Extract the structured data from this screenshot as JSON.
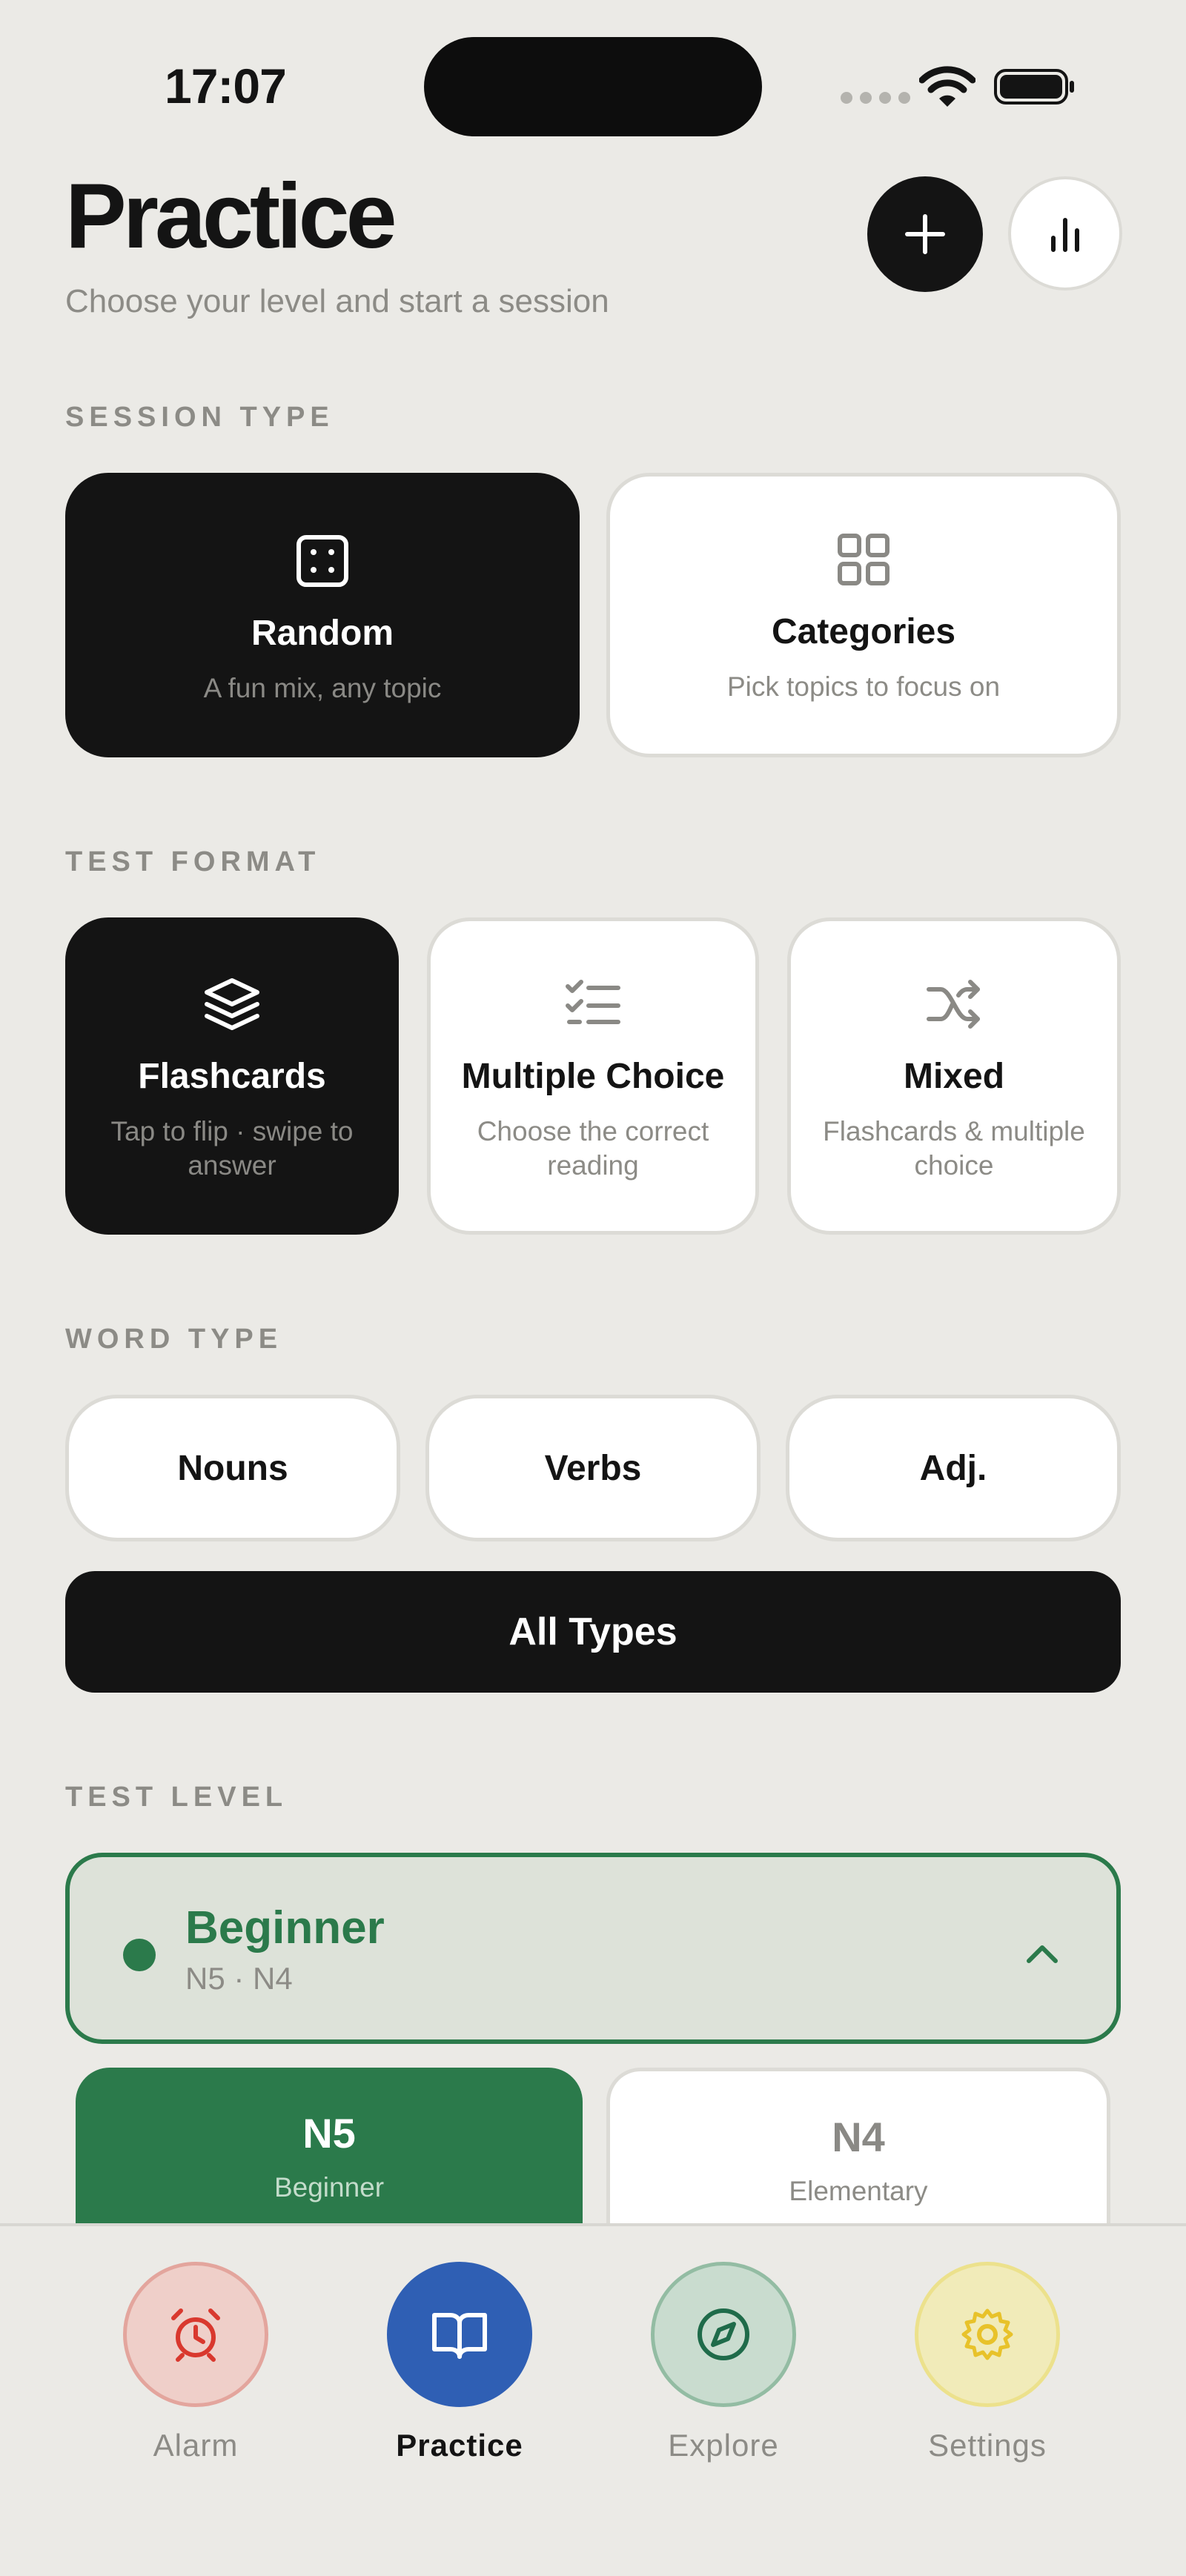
{
  "status_bar": {
    "time": "17:07"
  },
  "header": {
    "title": "Practice",
    "subtitle": "Choose your level and start a session",
    "add_icon": "plus-icon",
    "stats_icon": "bar-chart-icon"
  },
  "session_type": {
    "label": "SESSION TYPE",
    "options": [
      {
        "title": "Random",
        "desc": "A fun mix, any topic",
        "icon": "dice-icon",
        "selected": true
      },
      {
        "title": "Categories",
        "desc": "Pick topics to focus on",
        "icon": "grid-icon",
        "selected": false
      }
    ]
  },
  "test_format": {
    "label": "TEST FORMAT",
    "options": [
      {
        "title": "Flashcards",
        "desc": "Tap to flip · swipe to answer",
        "icon": "layers-icon",
        "selected": true
      },
      {
        "title": "Multiple Choice",
        "desc": "Choose the correct reading",
        "icon": "checklist-icon",
        "selected": false
      },
      {
        "title": "Mixed",
        "desc": "Flashcards & multiple choice",
        "icon": "shuffle-icon",
        "selected": false
      }
    ]
  },
  "word_type": {
    "label": "WORD TYPE",
    "options": [
      "Nouns",
      "Verbs",
      "Adj."
    ],
    "all_label": "All Types",
    "all_selected": true
  },
  "test_level": {
    "label": "TEST LEVEL",
    "group": {
      "name": "Beginner",
      "levels_text": "N5 · N4",
      "expanded": true
    },
    "levels": [
      {
        "code": "N5",
        "name": "Beginner",
        "selected": true
      },
      {
        "code": "N4",
        "name": "Elementary",
        "selected": false
      }
    ]
  },
  "colors": {
    "background": "#ebeae6",
    "dark": "#141414",
    "accent_green": "#2b7a4b",
    "alarm": "#d9382e",
    "practice": "#2f5fb4",
    "explore": "#1f6b4a",
    "settings": "#e8c22a"
  },
  "tabbar": {
    "tabs": [
      {
        "label": "Alarm",
        "icon": "alarm-clock-icon",
        "active": false
      },
      {
        "label": "Practice",
        "icon": "book-icon",
        "active": true
      },
      {
        "label": "Explore",
        "icon": "compass-icon",
        "active": false
      },
      {
        "label": "Settings",
        "icon": "gear-icon",
        "active": false
      }
    ]
  }
}
